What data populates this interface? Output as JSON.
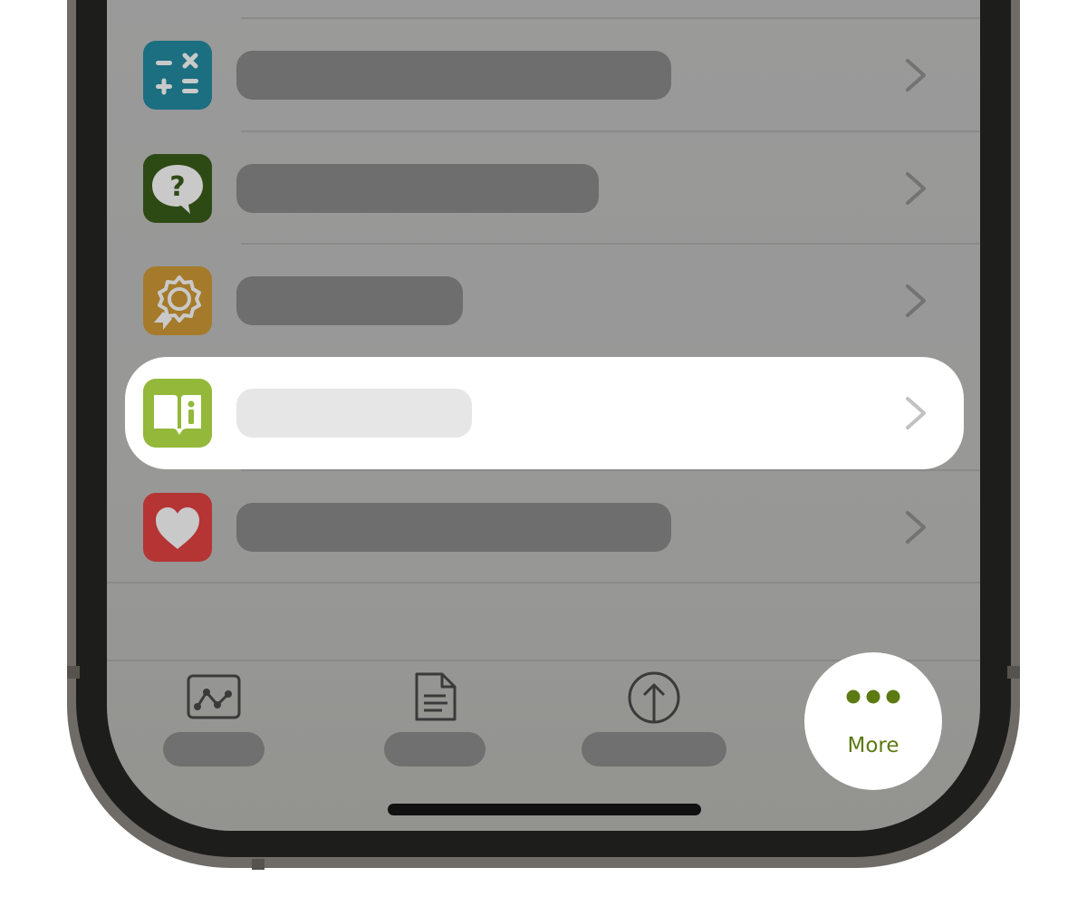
{
  "menu": {
    "items": [
      {
        "id": "calculator",
        "icon": "calculator-icon",
        "color": "#1b6f80"
      },
      {
        "id": "help",
        "icon": "question-bubble-icon",
        "color": "#2e4a14"
      },
      {
        "id": "award",
        "icon": "award-badge-icon",
        "color": "#a57a2a"
      },
      {
        "id": "info",
        "icon": "info-book-icon",
        "color": "#93b83a",
        "highlighted": true
      },
      {
        "id": "favorites",
        "icon": "heart-icon",
        "color": "#b53434"
      }
    ]
  },
  "tabbar": {
    "tabs": [
      {
        "id": "chart",
        "icon": "chart-icon"
      },
      {
        "id": "document",
        "icon": "document-icon"
      },
      {
        "id": "upload",
        "icon": "upload-icon"
      },
      {
        "id": "more",
        "icon": "more-dots-icon",
        "label": "More",
        "active": true
      }
    ],
    "accent": "#5c7a12"
  }
}
